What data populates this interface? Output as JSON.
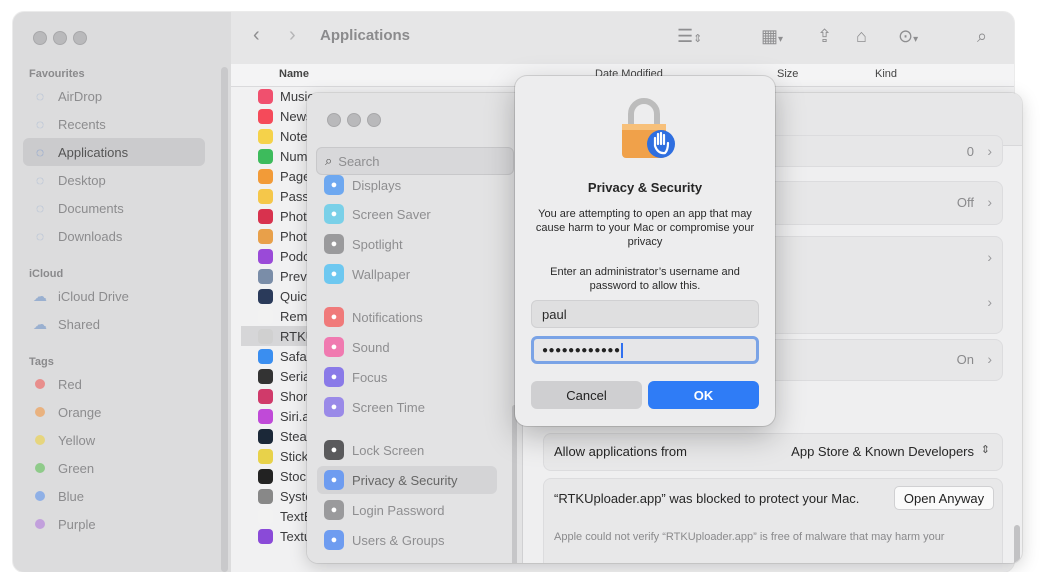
{
  "finder": {
    "title": "Applications",
    "sidebar": {
      "favourites_label": "Favourites",
      "favourites": [
        {
          "label": "AirDrop",
          "icon": "airdrop-icon"
        },
        {
          "label": "Recents",
          "icon": "clock-icon"
        },
        {
          "label": "Applications",
          "icon": "applications-icon",
          "selected": true
        },
        {
          "label": "Desktop",
          "icon": "desktop-icon"
        },
        {
          "label": "Documents",
          "icon": "document-icon"
        },
        {
          "label": "Downloads",
          "icon": "download-icon"
        }
      ],
      "icloud_label": "iCloud",
      "icloud": [
        {
          "label": "iCloud Drive",
          "icon": "cloud-icon"
        },
        {
          "label": "Shared",
          "icon": "shared-folder-icon"
        }
      ],
      "tags_label": "Tags",
      "tags": [
        {
          "label": "Red",
          "color": "#e88e8c"
        },
        {
          "label": "Orange",
          "color": "#e9b27f"
        },
        {
          "label": "Yellow",
          "color": "#e6d57e"
        },
        {
          "label": "Green",
          "color": "#8fcb8a"
        },
        {
          "label": "Blue",
          "color": "#8fb0e6"
        },
        {
          "label": "Purple",
          "color": "#c2a0dc"
        }
      ]
    },
    "columns": {
      "name": "Name",
      "date": "Date Modified",
      "size": "Size",
      "kind": "Kind"
    },
    "files": [
      {
        "label": "Music",
        "color": "#f0506e"
      },
      {
        "label": "News",
        "color": "#f54a5a"
      },
      {
        "label": "Note",
        "color": "#f5d24a"
      },
      {
        "label": "Num",
        "color": "#3dbb5c"
      },
      {
        "label": "Page",
        "color": "#f29b38"
      },
      {
        "label": "Pass",
        "color": "#f5c74a"
      },
      {
        "label": "Phot",
        "color": "#d8324e"
      },
      {
        "label": "Phot",
        "color": "#e8a04a"
      },
      {
        "label": "Podc",
        "color": "#9a4ad8"
      },
      {
        "label": "Prev",
        "color": "#7a8da8"
      },
      {
        "label": "Quic",
        "color": "#2a3a5a"
      },
      {
        "label": "Rem",
        "color": "#f2f2f2"
      },
      {
        "label": "RTKU",
        "color": "#d0d0d0",
        "selected": true
      },
      {
        "label": "Safa",
        "color": "#3a8ef0"
      },
      {
        "label": "Seria",
        "color": "#333"
      },
      {
        "label": "Shor",
        "color": "#d03a6a"
      },
      {
        "label": "Siri.a",
        "color": "#c04ad8"
      },
      {
        "label": "Stea",
        "color": "#1b2838"
      },
      {
        "label": "Stick",
        "color": "#e8d24a"
      },
      {
        "label": "Stoc",
        "color": "#222"
      },
      {
        "label": "Syste",
        "color": "#888"
      },
      {
        "label": "TextE",
        "color": "#f2f2f2"
      },
      {
        "label": "Textu",
        "color": "#8a4ad8"
      }
    ]
  },
  "settings": {
    "search_placeholder": "Search",
    "sidebar": [
      {
        "label": "Displays",
        "color": "#6ea8f0"
      },
      {
        "label": "Screen Saver",
        "color": "#7ad0e8"
      },
      {
        "label": "Spotlight",
        "color": "#9a9a9c"
      },
      {
        "label": "Wallpaper",
        "color": "#6ec8f0"
      },
      {
        "label": "Notifications",
        "color": "#f07a7a"
      },
      {
        "label": "Sound",
        "color": "#f07ab0"
      },
      {
        "label": "Focus",
        "color": "#8a7ae8"
      },
      {
        "label": "Screen Time",
        "color": "#9a8ae8"
      },
      {
        "label": "Lock Screen",
        "color": "#5a5a5c"
      },
      {
        "label": "Privacy & Security",
        "color": "#6e9cf0",
        "selected": true
      },
      {
        "label": "Login Password",
        "color": "#9a9a9c"
      },
      {
        "label": "Users & Groups",
        "color": "#6e9cf0"
      }
    ],
    "rows": {
      "row1_value": "0",
      "row2_value": "Off",
      "row5_value": "On"
    },
    "allow_label": "Allow applications from",
    "allow_value": "App Store & Known Developers",
    "blocked_text": "“RTKUploader.app” was blocked to protect your Mac.",
    "open_anyway": "Open Anyway",
    "footer_text": "Apple could not verify “RTKUploader.app” is free of malware that may harm your"
  },
  "dialog": {
    "title": "Privacy & Security",
    "message": "You are attempting to open an app that may cause harm to your Mac or compromise your privacy",
    "instruction": "Enter an administrator’s username and password to allow this.",
    "username": "paul",
    "password_mask": "●●●●●●●●●●●●",
    "cancel": "Cancel",
    "ok": "OK"
  }
}
